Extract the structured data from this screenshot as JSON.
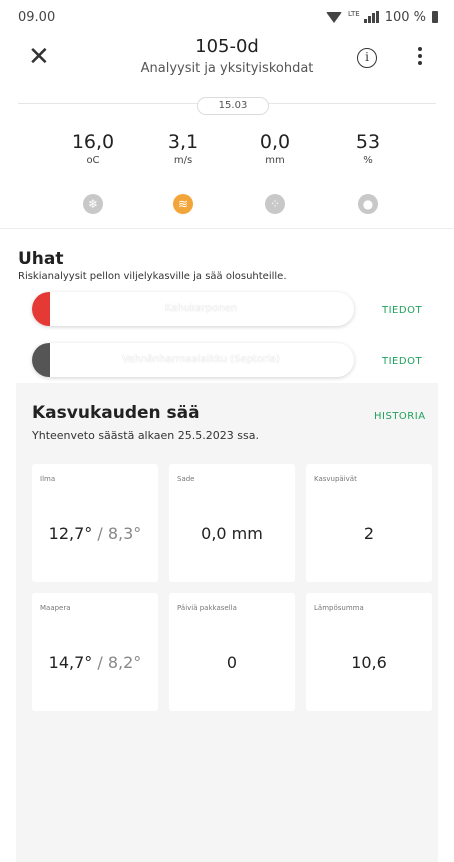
{
  "status": {
    "time": "09.00",
    "network": "LTE",
    "battery": "100 %"
  },
  "header": {
    "title": "105-0d",
    "subtitle": "Analyysit ja yksityiskohdat",
    "close_icon": "close-icon",
    "info_icon": "info-icon",
    "more_icon": "more-vert-icon"
  },
  "weather": {
    "date": "15.03",
    "metrics": [
      {
        "value": "16,0",
        "unit": "oC"
      },
      {
        "value": "3,1",
        "unit": "m/s"
      },
      {
        "value": "0,0",
        "unit": "mm"
      },
      {
        "value": "53",
        "unit": "%"
      }
    ],
    "icons": [
      {
        "name": "snowflake-icon",
        "glyph": "❄"
      },
      {
        "name": "wind-icon",
        "glyph": "≋"
      },
      {
        "name": "rain-icon",
        "glyph": "⁘"
      },
      {
        "name": "humidity-icon",
        "glyph": "💧"
      }
    ],
    "active_color": "#f2a53a"
  },
  "threats": {
    "title": "Uhat",
    "description": "Riskianalyysit pellon viljelykasville ja sää olosuhteille.",
    "items": [
      {
        "label": "Kahukarponen",
        "status_color": "#e53935",
        "action": "TIEDOT"
      },
      {
        "label": "Vehnänharmaalaikku (Septoria)",
        "status_color": "#555555",
        "action": "TIEDOT"
      }
    ]
  },
  "season": {
    "title": "Kasvukauden sää",
    "history_link": "HISTORIA",
    "subtitle": "Yhteenveto säästä alkaen 25.5.2023 ssa.",
    "cards": [
      {
        "label": "Ilma",
        "main": "12,7°",
        "secondary": " / 8,3°"
      },
      {
        "label": "Sade",
        "main": "0,0 mm",
        "secondary": ""
      },
      {
        "label": "Kasvupäivät",
        "main": "2",
        "secondary": ""
      },
      {
        "label": "Maapera",
        "main": "14,7°",
        "secondary": " / 8,2°"
      },
      {
        "label": "Päiviä pakkasella",
        "main": "0",
        "secondary": ""
      },
      {
        "label": "Lämpösumma",
        "main": "10,6",
        "secondary": ""
      }
    ]
  },
  "colors": {
    "accent_green": "#1fa05a",
    "risk_red": "#e53935",
    "risk_dark": "#555555"
  }
}
